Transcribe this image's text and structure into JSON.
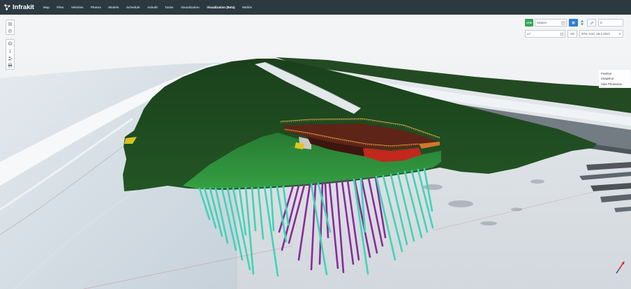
{
  "app": {
    "name": "Infrakit",
    "logo_icon": "infrakit-logo-icon"
  },
  "nav": {
    "items": [
      {
        "label": "Map",
        "active": false
      },
      {
        "label": "Files",
        "active": false
      },
      {
        "label": "Vehicles",
        "active": false
      },
      {
        "label": "Photos",
        "active": false
      },
      {
        "label": "Models",
        "active": false
      },
      {
        "label": "Schedule",
        "active": false
      },
      {
        "label": "Asbuilt",
        "active": false
      },
      {
        "label": "Tasks",
        "active": false
      },
      {
        "label": "Visualization",
        "active": false
      },
      {
        "label": "Visualization (Beta)",
        "active": true
      },
      {
        "label": "Mobile",
        "active": false
      }
    ]
  },
  "left_toolbar": {
    "top_group": [
      "menu-icon",
      "crosshair-icon"
    ],
    "bottom_group": [
      "layers-icon",
      "info-icon",
      "user-location-icon",
      "print-icon"
    ]
  },
  "view_controls": {
    "layer_badge": "DTM",
    "station_select": "Station",
    "offset_value": "0",
    "elevation_value": "±7",
    "mode_label": "2D",
    "basemap_select": "RTK Grid, 28.1.2021",
    "icons": [
      "expand-icon",
      "list-icon",
      "stepper-icon",
      "edit-icon",
      "crop-icon",
      "chevron-down-icon"
    ]
  },
  "context_menu": {
    "items": [
      "Position",
      "Snapshot",
      "Hide Photoview"
    ]
  },
  "compass": {
    "icon": "compass-icon"
  },
  "colors": {
    "nav_bg": "#2c3941",
    "badge_green": "#3aa357",
    "button_blue": "#2f7fd1",
    "pile_cyan": "#3fd4b6",
    "pile_purple": "#8b2a98"
  }
}
